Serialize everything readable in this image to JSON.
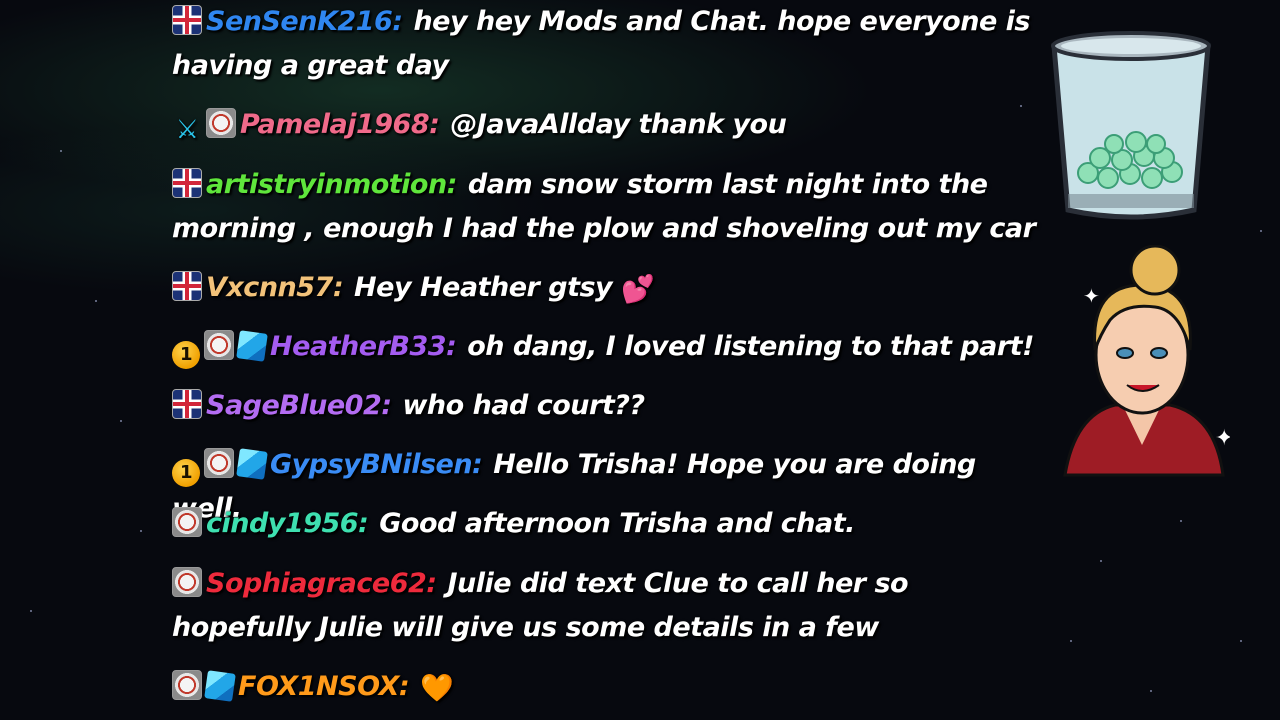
{
  "chat": {
    "messages": [
      {
        "badges": [
          "flag"
        ],
        "user": "SenSenK216:",
        "user_color": "#2f86f0",
        "text": "hey hey Mods and Chat. hope everyone is having a great day"
      },
      {
        "badges": [
          "sword",
          "avatar"
        ],
        "user": "Pamelaj1968:",
        "user_color": "#f06a8a",
        "text": "@JavaAllday thank you"
      },
      {
        "badges": [
          "flag"
        ],
        "user": "artistryinmotion:",
        "user_color": "#5fe63c",
        "text": "dam snow storm last night into the morning , enough I had the plow and shoveling out my car"
      },
      {
        "badges": [
          "flag"
        ],
        "user": "Vxcnn57:",
        "user_color": "#f2c27a",
        "text": "Hey Heather gtsy",
        "emote": "💕"
      },
      {
        "badges": [
          "tier",
          "avatar",
          "cube"
        ],
        "user": "HeatherB33:",
        "user_color": "#a45cf0",
        "text": "oh dang, I loved listening to that part!"
      },
      {
        "badges": [
          "flag"
        ],
        "user": "SageBlue02:",
        "user_color": "#b36cf2",
        "text": "who had court??"
      },
      {
        "badges": [
          "tier",
          "avatar",
          "cube"
        ],
        "user": "GypsyBNilsen:",
        "user_color": "#3a8cf5",
        "text": "Hello Trisha! Hope you are doing well."
      },
      {
        "badges": [
          "avatar"
        ],
        "user": "cindy1956:",
        "user_color": "#3ee0b0",
        "text": "Good afternoon Trisha and chat."
      },
      {
        "badges": [
          "avatar"
        ],
        "user": "Sophiagrace62:",
        "user_color": "#ee2a3c",
        "text": "Julie did text Clue to call her so hopefully Julie will give us some details in a few"
      },
      {
        "badges": [
          "avatar",
          "cube"
        ],
        "user": "FOX1NSOX:",
        "user_color": "#ff9a1a",
        "text": "",
        "emote": "🧡"
      }
    ],
    "tier_badge_text": "1"
  },
  "overlay": {
    "cup_icon": "tip-jar-icon",
    "mascot_icon": "streamer-avatar-icon"
  }
}
